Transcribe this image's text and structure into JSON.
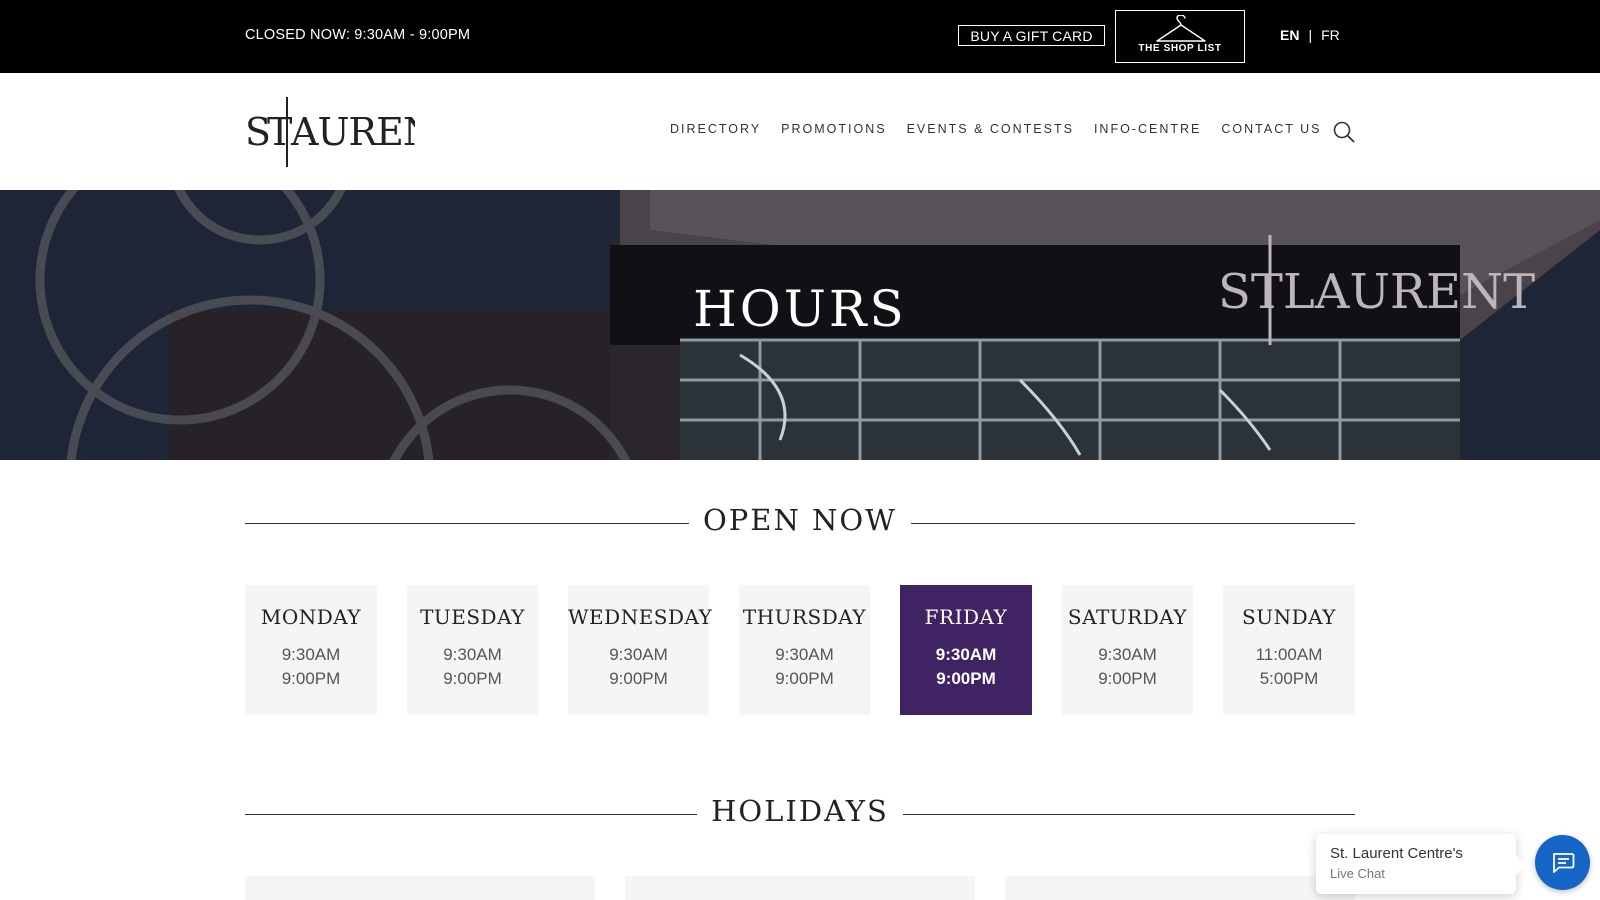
{
  "topbar": {
    "status": "CLOSED NOW: 9:30AM - 9:00PM",
    "gift_card_label": "BUY A GIFT CARD",
    "shop_list_label": "THE SHOP LIST",
    "shop_list_icon": "hanger-icon",
    "lang_en": "EN",
    "lang_sep": "|",
    "lang_fr": "FR"
  },
  "header": {
    "logo_text": "STLAURENT",
    "nav": [
      "DIRECTORY",
      "PROMOTIONS",
      "EVENTS & CONTESTS",
      "INFO-CENTRE",
      "CONTACT US"
    ],
    "search_icon": "search-icon"
  },
  "hero": {
    "title": "HOURS",
    "sign_text": "STLAURENT"
  },
  "open_now": {
    "heading": "OPEN NOW",
    "days": [
      {
        "name": "MONDAY",
        "open": "9:30AM",
        "close": "9:00PM"
      },
      {
        "name": "TUESDAY",
        "open": "9:30AM",
        "close": "9:00PM"
      },
      {
        "name": "WEDNESDAY",
        "open": "9:30AM",
        "close": "9:00PM"
      },
      {
        "name": "THURSDAY",
        "open": "9:30AM",
        "close": "9:00PM"
      },
      {
        "name": "FRIDAY",
        "open": "9:30AM",
        "close": "9:00PM"
      },
      {
        "name": "SATURDAY",
        "open": "9:30AM",
        "close": "9:00PM"
      },
      {
        "name": "SUNDAY",
        "open": "11:00AM",
        "close": "5:00PM"
      }
    ],
    "active_day": "FRIDAY",
    "active_color": "#3f2363"
  },
  "holidays": {
    "heading": "HOLIDAYS"
  },
  "chat": {
    "name": "St. Laurent Centre's",
    "subtitle": "Live Chat",
    "button_icon": "chat-icon",
    "button_color": "#1565c7"
  }
}
